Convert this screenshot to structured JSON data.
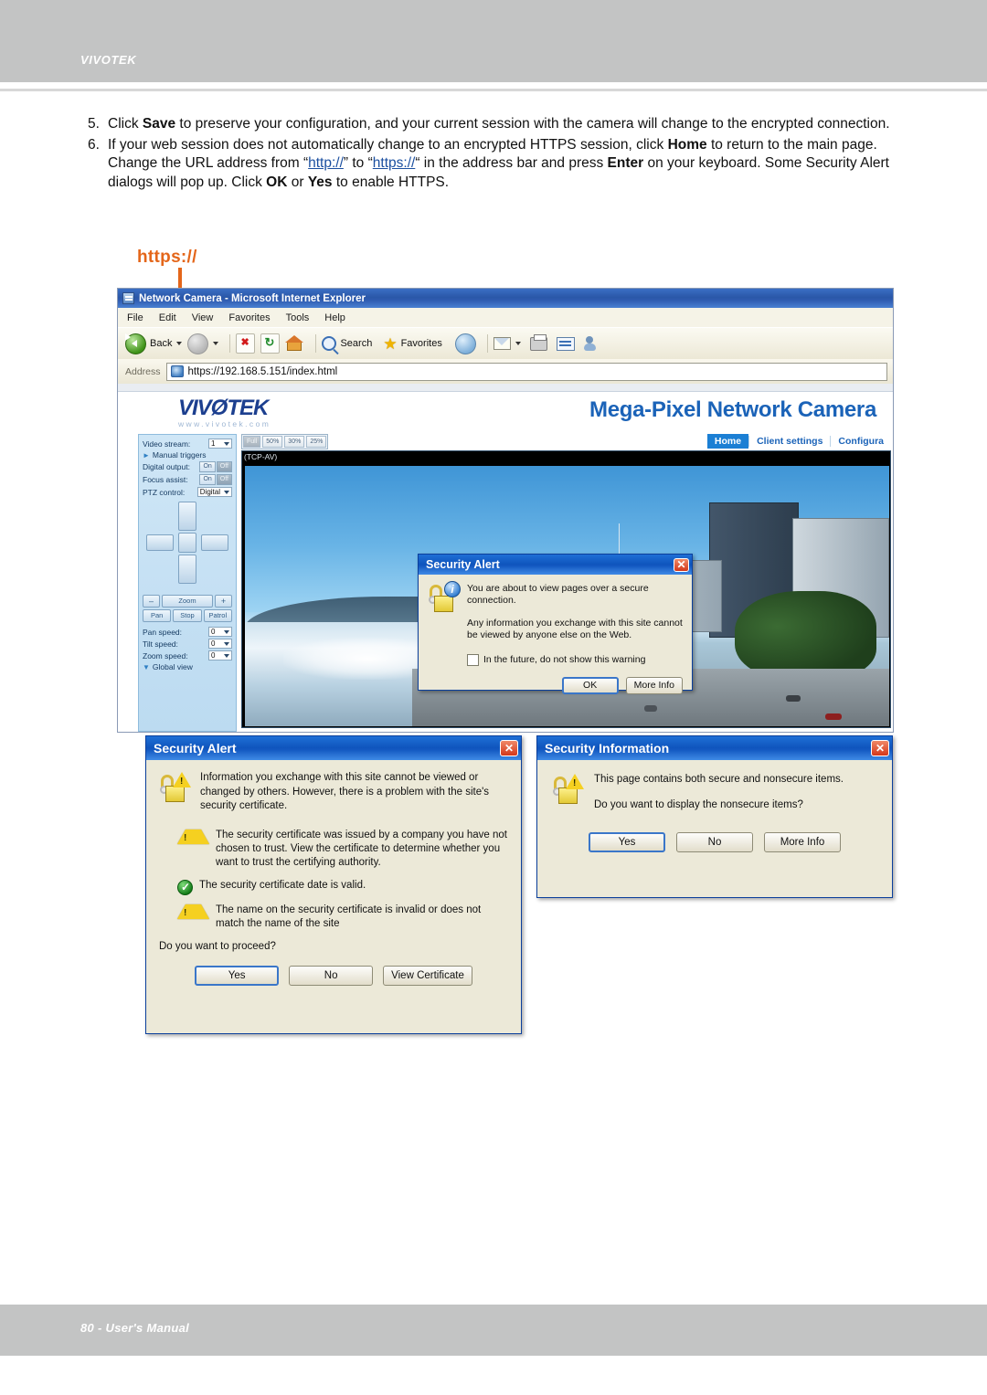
{
  "page": {
    "brand": "VIVOTEK",
    "footer": "80 - User's Manual"
  },
  "steps": [
    {
      "num": "5.",
      "parts": [
        {
          "t": "Click ",
          "b": false
        },
        {
          "t": "Save",
          "b": true
        },
        {
          "t": " to preserve your configuration, and your current session with the camera will change to the encrypted connection.",
          "b": false
        }
      ]
    },
    {
      "num": "6.",
      "parts": [
        {
          "t": "If your web session does not automatically change to an encrypted HTTPS session, click ",
          "b": false
        },
        {
          "t": "Home",
          "b": true
        },
        {
          "t": " to return to the main page. Change the URL address from “",
          "b": false
        },
        {
          "t": "http://",
          "link": true
        },
        {
          "t": "” to “",
          "b": false
        },
        {
          "t": "https://",
          "link": true
        },
        {
          "t": "“ in the address bar and press ",
          "b": false
        },
        {
          "t": "Enter",
          "b": true
        },
        {
          "t": " on your keyboard. Some Security Alert dialogs will pop up. Click ",
          "b": false
        },
        {
          "t": "OK",
          "b": true
        },
        {
          "t": " or ",
          "b": false
        },
        {
          "t": "Yes",
          "b": true
        },
        {
          "t": " to enable HTTPS.",
          "b": false
        }
      ]
    }
  ],
  "callout": {
    "label": "https://",
    "color": "#e4661a"
  },
  "browser": {
    "title": "Network Camera - Microsoft Internet Explorer",
    "menus": [
      "File",
      "Edit",
      "View",
      "Favorites",
      "Tools",
      "Help"
    ],
    "toolbar": {
      "back_label": "Back",
      "search_label": "Search",
      "favorites_label": "Favorites"
    },
    "address": {
      "label": "Address",
      "url": "https://192.168.5.151/index.html"
    }
  },
  "camera": {
    "logo": "VIVØTEK",
    "logo_sub": "www.vivotek.com",
    "title": "Mega-Pixel Network Camera",
    "nav": [
      "Home",
      "Client settings",
      "Configura"
    ],
    "nav_active": "Home",
    "quality_buttons": [
      "Full",
      "50%",
      "30%",
      "25%"
    ],
    "quality_active": "Full",
    "stream_label": "(TCP-AV)",
    "sidebar": {
      "video_stream_label": "Video stream:",
      "video_stream_value": "1",
      "manual_triggers": "Manual triggers",
      "digital_output_label": "Digital output:",
      "digital_output_on": "On",
      "digital_output_off": "Off",
      "focus_assist_label": "Focus assist:",
      "focus_assist_on": "On",
      "focus_assist_off": "Off",
      "ptz_control_label": "PTZ control:",
      "ptz_control_value": "Digital",
      "zoom_minus": "–",
      "zoom_label": "Zoom",
      "zoom_plus": "+",
      "pan_btn": "Pan",
      "stop_btn": "Stop",
      "patrol_btn": "Patrol",
      "pan_speed_label": "Pan speed:",
      "pan_speed_value": "0",
      "tilt_speed_label": "Tilt speed:",
      "tilt_speed_value": "0",
      "zoom_speed_label": "Zoom speed:",
      "zoom_speed_value": "0",
      "global_view": "Global view"
    }
  },
  "dialog_secure_connection": {
    "title": "Security Alert",
    "line1": "You are about to view pages over a secure connection.",
    "line2": "Any information you exchange with this site cannot be viewed by anyone else on the Web.",
    "checkbox": "In the future, do not show this warning",
    "buttons": [
      "OK",
      "More Info"
    ]
  },
  "dialog_certificate": {
    "title": "Security Alert",
    "intro": "Information you exchange with this site cannot be viewed or changed by others. However, there is a problem with the site's security certificate.",
    "items": [
      {
        "icon": "warning-icon",
        "text": "The security certificate was issued by a company you have not chosen to trust. View the certificate to determine whether you want to trust the certifying authority."
      },
      {
        "icon": "ok-icon",
        "text": "The security certificate date is valid."
      },
      {
        "icon": "warning-icon",
        "text": "The name on the security certificate is invalid or does not match the name of the site"
      }
    ],
    "question": "Do you want to proceed?",
    "buttons": [
      "Yes",
      "No",
      "View Certificate"
    ]
  },
  "dialog_security_information": {
    "title": "Security Information",
    "line1": "This page contains both secure and nonsecure items.",
    "question": "Do you want to display the nonsecure items?",
    "buttons": [
      "Yes",
      "No",
      "More Info"
    ]
  }
}
